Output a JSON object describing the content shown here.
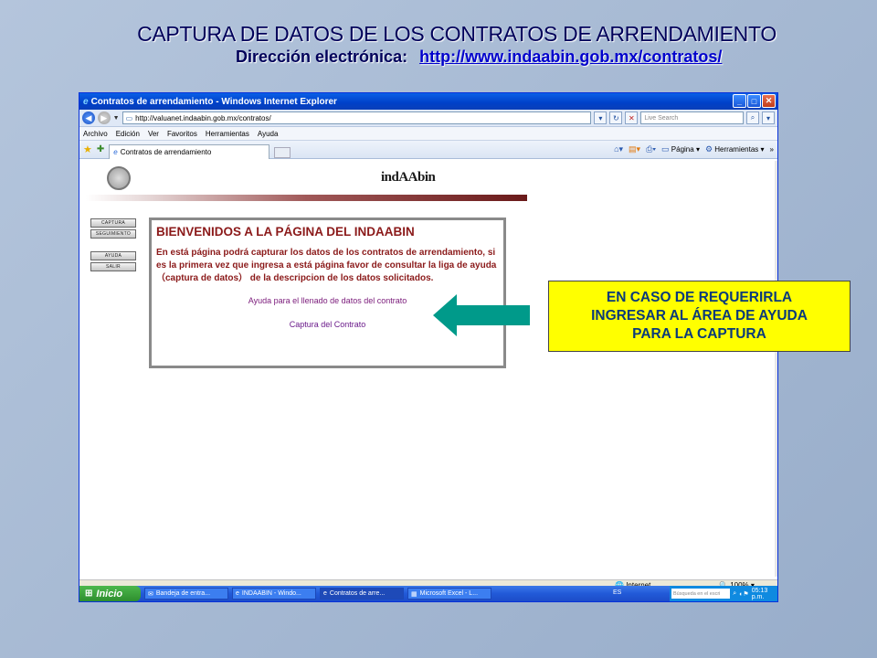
{
  "slide": {
    "title": "CAPTURA DE DATOS DE LOS CONTRATOS DE ARRENDAMIENTO",
    "subtitle_label": "Dirección electrónica:",
    "subtitle_url": "http://www.indaabin.gob.mx/contratos/"
  },
  "browser": {
    "window_title": "Contratos de arrendamiento - Windows Internet Explorer",
    "address": "http://valuanet.indaabin.gob.mx/contratos/",
    "search_placeholder": "Live Search",
    "menu": [
      "Archivo",
      "Edición",
      "Ver",
      "Favoritos",
      "Herramientas",
      "Ayuda"
    ],
    "tab_label": "Contratos de arrendamiento",
    "cmd_page": "Página",
    "cmd_tools": "Herramientas",
    "status_zone": "Internet",
    "status_zoom": "100%"
  },
  "site": {
    "logo_text": "indAAbin",
    "side_buttons": [
      "CAPTURA",
      "SEGUIMIENTO",
      "AYUDA",
      "SALIR"
    ],
    "welcome_title": "BIENVENIDOS A LA PÁGINA DEL INDAABIN",
    "welcome_text": "En está página podrá capturar los datos de los contratos de arrendamiento, si es la primera vez que ingresa a está página favor de consultar  la liga de ayuda （captura de datos） de la descripcion de los datos solicitados.",
    "link_help": "Ayuda para el llenado de datos del contrato",
    "link_capture": "Captura del Contrato"
  },
  "taskbar": {
    "start": "Inicio",
    "tasks": [
      "Bandeja de entra...",
      "INDAABIN - Windo...",
      "Contratos de arre...",
      "Microsoft Excel - L..."
    ],
    "lang": "ES",
    "search_placeholder": "Búsqueda en el escri",
    "clock": "05:13 p.m."
  },
  "callout": {
    "lines": [
      "EN CASO DE REQUERIRLA",
      "INGRESAR AL ÁREA DE AYUDA",
      "PARA LA CAPTURA"
    ],
    "bg_color": "#ffff00",
    "arrow_color": "#009a8a"
  }
}
